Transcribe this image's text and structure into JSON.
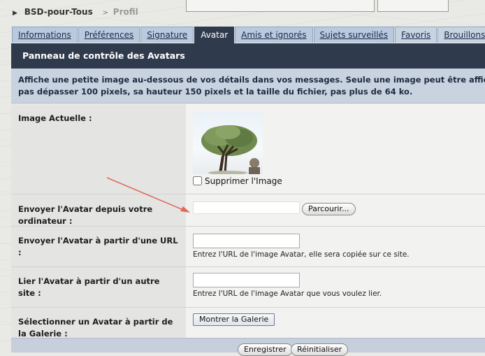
{
  "breadcrumb": {
    "site": "BSD-pour-Tous",
    "separator": ">",
    "current": "Profil"
  },
  "tabs": [
    {
      "label": "Informations",
      "active": false
    },
    {
      "label": "Préférences",
      "active": false
    },
    {
      "label": "Signature",
      "active": false
    },
    {
      "label": "Avatar",
      "active": true
    },
    {
      "label": "Amis et ignorés",
      "active": false
    },
    {
      "label": "Sujets surveillés",
      "active": false
    },
    {
      "label": "Favoris",
      "active": false
    },
    {
      "label": "Brouillons",
      "active": false
    }
  ],
  "panel": {
    "title": "Panneau de contrôle des Avatars",
    "description_line1": "Affiche une petite image au-dessous de vos détails dans vos messages. Seule une image peut être affichée à la fois, sa",
    "description_line2": "pas dépasser 100 pixels, sa hauteur 150 pixels et la taille du fichier, pas plus de 64 ko."
  },
  "current_image": {
    "label": "Image Actuelle :",
    "delete_label": "Supprimer l'Image",
    "delete_checked": false
  },
  "upload": {
    "label": "Envoyer l'Avatar depuis votre ordinateur :",
    "value": "",
    "browse_label": "Parcourir..."
  },
  "upload_url": {
    "label": "Envoyer l'Avatar à partir d'une URL :",
    "value": "",
    "hint": "Entrez l'URL de l'image Avatar, elle sera copiée sur ce site."
  },
  "link_remote": {
    "label": "Lier l'Avatar à partir d'un autre site :",
    "value": "",
    "hint": "Entrez l'URL de l'image Avatar que vous voulez lier."
  },
  "gallery": {
    "label": "Sélectionner un Avatar à partir de la Galerie :",
    "button_label": "Montrer la Galerie"
  },
  "footer": {
    "submit_label": "Enregistrer",
    "reset_label": "Réinitialiser"
  },
  "colors": {
    "header_bg": "#2f3b4d",
    "tab_bg": "#b9cade",
    "desc_bg": "#c9d3e0",
    "annotation_arrow": "#e0685a"
  }
}
